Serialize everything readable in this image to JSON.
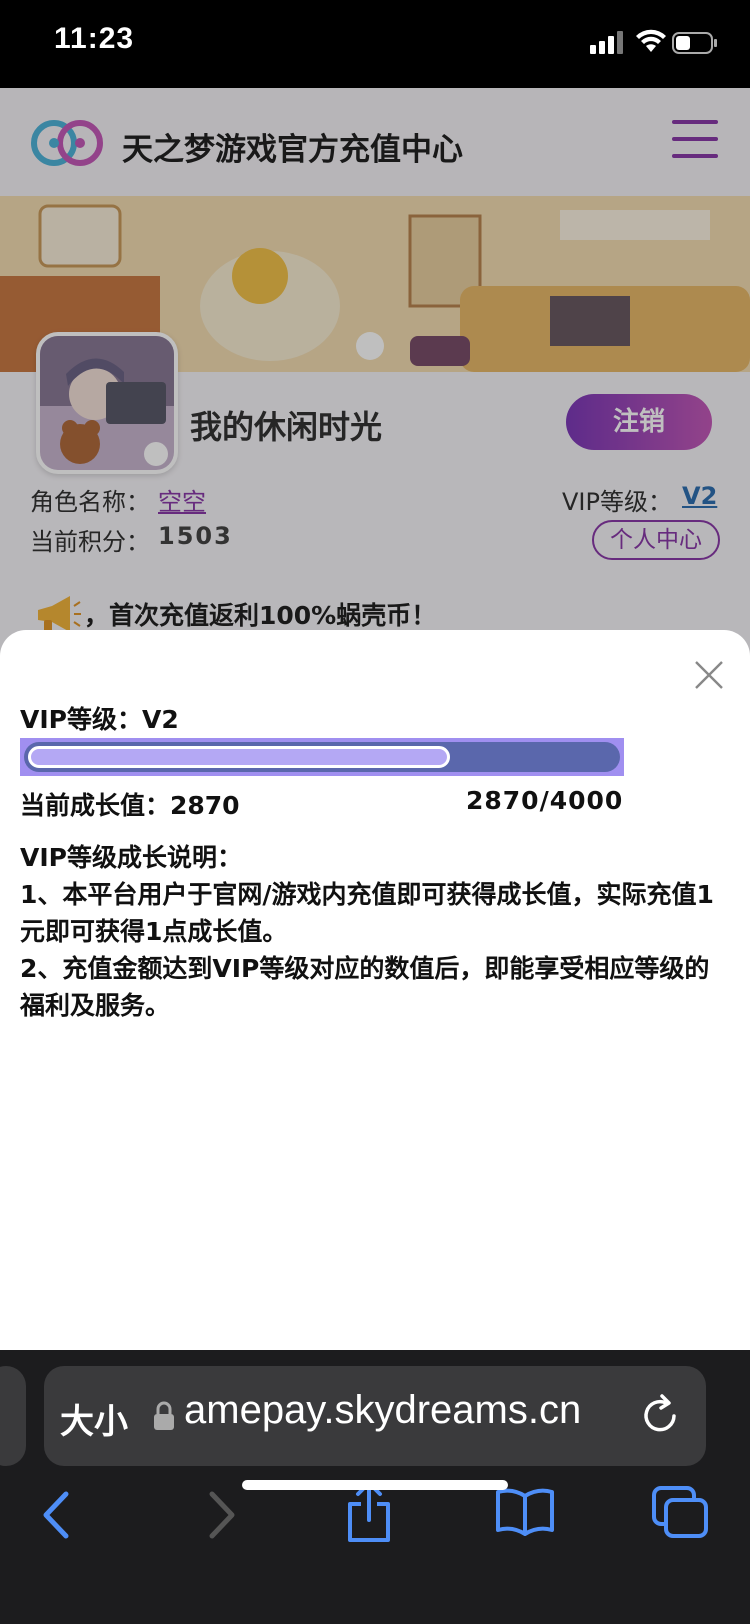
{
  "status_bar": {
    "time": "11:23"
  },
  "header": {
    "title": "天之梦游戏官方充值中心"
  },
  "profile": {
    "username": "我的休闲时光",
    "logout_label": "注销",
    "role_label": "角色名称：",
    "role_name": "空空",
    "vip_label": "VIP等级：",
    "vip_value": "V2",
    "points_label": "当前积分：",
    "points_value": "1503",
    "personal_center_label": "个人中心"
  },
  "promo": {
    "text": "，首次充值返利100%蜗壳币！"
  },
  "modal": {
    "vip_title": "VIP等级：V2",
    "growth_label": "当前成长值：2870",
    "growth_ratio": "2870/4000",
    "progress_fraction": 0.7175,
    "desc_title": "VIP等级成长说明：",
    "desc_1": "1、本平台用户于官网/游戏内充值即可获得成长值，实际充值1元即可获得1点成长值。",
    "desc_2": "2、充值金额达到VIP等级对应的数值后，即能享受相应等级的福利及服务。"
  },
  "browser": {
    "text_size_label": "大小",
    "url": "amepay.skydreams.cn"
  },
  "colors": {
    "accent_purple": "#8a3aa8",
    "progress_fill": "#b4a8f4",
    "progress_track": "#5a67ac",
    "browser_icon": "#4e8ef7"
  },
  "icons": [
    "signal-icon",
    "wifi-icon",
    "battery-icon",
    "logo-icon",
    "menu-icon",
    "megaphone-icon",
    "close-icon",
    "lock-icon",
    "reload-icon",
    "back-icon",
    "forward-icon",
    "share-icon",
    "bookmarks-icon",
    "tabs-icon"
  ]
}
